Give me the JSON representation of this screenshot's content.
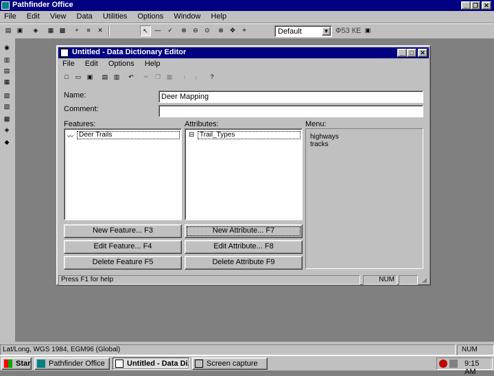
{
  "app": {
    "title": "Pathfinder Office",
    "menu": [
      "File",
      "Edit",
      "View",
      "Data",
      "Utilities",
      "Options",
      "Window",
      "Help"
    ],
    "coordinate_combo": "Default",
    "coordinate_label": "Ф53 КЕ"
  },
  "dialog": {
    "title": "Untitled - Data Dictionary Editor",
    "menu": [
      "File",
      "Edit",
      "Options",
      "Help"
    ],
    "name_label": "Name:",
    "name_value": "Deer Mapping",
    "comment_label": "Comment:",
    "comment_value": "",
    "features_label": "Features:",
    "features": [
      "Deer Trails"
    ],
    "attributes_label": "Attributes:",
    "attributes": [
      "Trail_Types"
    ],
    "menu_label": "Menu:",
    "menu_items": [
      "highways",
      "tracks"
    ],
    "buttons": {
      "new_feature": "New Feature... F3",
      "edit_feature": "Edit Feature... F4",
      "delete_feature": "Delete Feature F5",
      "new_attribute": "New Attribute... F7",
      "edit_attribute": "Edit Attribute... F8",
      "delete_attribute": "Delete Attribute F9"
    },
    "status_text": "Press F1 for help",
    "status_num": "NUM"
  },
  "statusbar": {
    "text": "Lat/Long, WGS 1984, EGM96 (Global)",
    "num": "NUM"
  },
  "taskbar": {
    "start": "Start",
    "tasks": [
      "Pathfinder Office",
      "Untitled - Data Di...",
      "Screen capture"
    ],
    "clock": "9:15 AM"
  },
  "colors": {
    "title_active": "#000080",
    "face": "#c0c0c0",
    "desktop": "#808080"
  }
}
